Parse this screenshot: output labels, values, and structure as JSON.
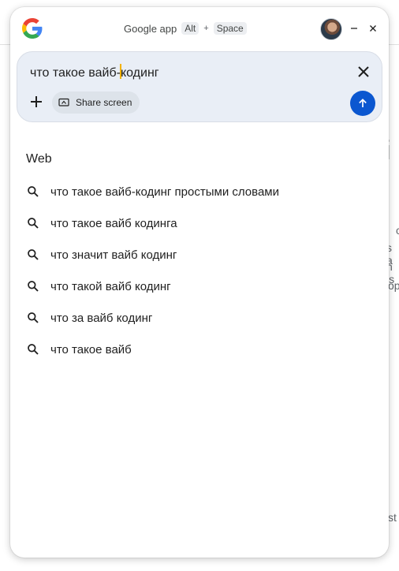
{
  "window": {
    "title": "Google app",
    "shortcut_key1": "Alt",
    "shortcut_plus": "+",
    "shortcut_key2": "Space"
  },
  "search": {
    "query_before_caret": "что такое вайб-",
    "query_after_caret": "кодинг",
    "share_screen_label": "Share screen"
  },
  "suggestions": {
    "section_label": "Web",
    "items": [
      "что такое вайб-кодинг простыми словами",
      "что такое вайб кодинга",
      "что значит вайб кодинг",
      "что такой вайб кодинг",
      "что за вайб кодинг",
      "что такое вайб"
    ]
  },
  "background_fragments": [
    "i",
    "c",
    "s a",
    "n is",
    "op",
    "st"
  ],
  "colors": {
    "accent": "#0b57d0",
    "searchbox_bg": "#e9eef6",
    "caret": "#f2b100"
  }
}
